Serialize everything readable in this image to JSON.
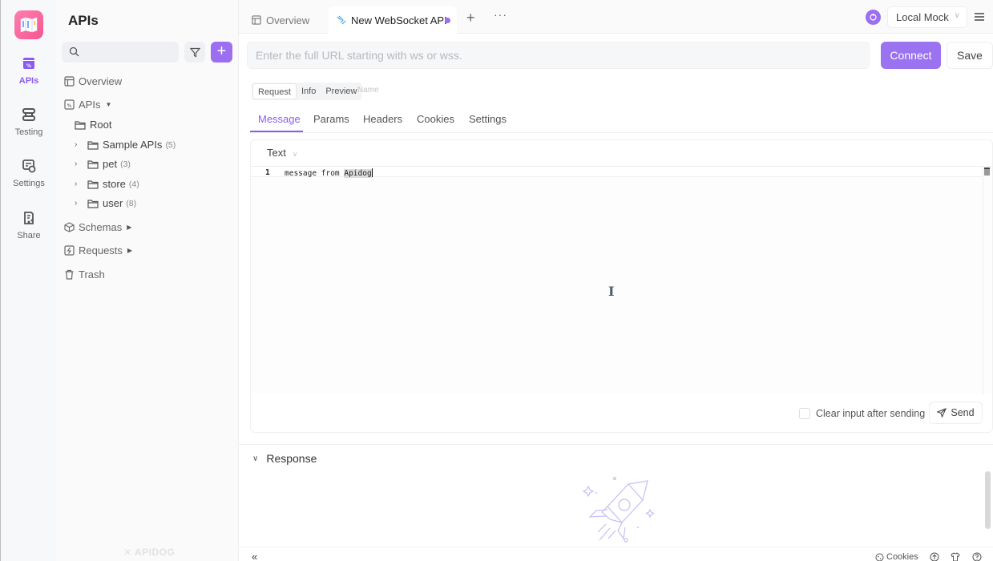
{
  "rail": {
    "items": [
      {
        "label": "APIs",
        "icon": "apis-icon",
        "active": true
      },
      {
        "label": "Testing",
        "icon": "testing-icon"
      },
      {
        "label": "Settings",
        "icon": "settings-icon"
      },
      {
        "label": "Share",
        "icon": "share-icon"
      }
    ]
  },
  "sidebar": {
    "title": "APIs",
    "search_placeholder": "",
    "tree": {
      "overview": "Overview",
      "apis": "APIs",
      "root": "Root",
      "folders": [
        {
          "name": "Sample APIs",
          "count": "(5)"
        },
        {
          "name": "pet",
          "count": "(3)"
        },
        {
          "name": "store",
          "count": "(4)"
        },
        {
          "name": "user",
          "count": "(8)"
        }
      ],
      "schemas": "Schemas",
      "requests": "Requests",
      "trash": "Trash"
    },
    "watermark": "APIDOG"
  },
  "tabs": {
    "overview": "Overview",
    "active": "New WebSocket API",
    "more": "···"
  },
  "env": {
    "selected": "Local Mock"
  },
  "request": {
    "url_value": "",
    "url_placeholder": "Enter the full URL starting with ws or wss.",
    "connect_label": "Connect",
    "save_label": "Save",
    "mode_tabs": [
      "Request",
      "Info",
      "Preview"
    ],
    "name_placeholder": "Name",
    "subtabs": [
      "Message",
      "Params",
      "Headers",
      "Cookies",
      "Settings"
    ],
    "active_subtab": "Message"
  },
  "message": {
    "type": "Text",
    "line_number": "1",
    "code_prefix": "message from ",
    "code_selected": "Apidog",
    "clear_input_label": "Clear input after sending",
    "clear_input_checked": false,
    "send_label": "Send"
  },
  "response": {
    "title": "Response"
  },
  "status_bar": {
    "collapse": "«",
    "cookies": "Cookies"
  },
  "colors": {
    "accent": "#9b72ef",
    "app_logo": "#f5568f"
  }
}
